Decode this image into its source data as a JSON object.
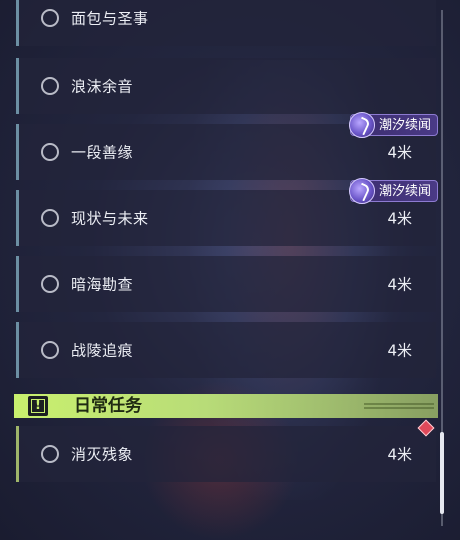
{
  "quests": [
    {
      "title": "面包与圣事",
      "distance": "",
      "tag": ""
    },
    {
      "title": "浪沫余音",
      "distance": "",
      "tag": ""
    },
    {
      "title": "一段善缘",
      "distance": "4米",
      "tag": "潮汐续闻"
    },
    {
      "title": "现状与未来",
      "distance": "4米",
      "tag": "潮汐续闻"
    },
    {
      "title": "暗海勘查",
      "distance": "4米",
      "tag": ""
    },
    {
      "title": "战陵追痕",
      "distance": "4米",
      "tag": ""
    }
  ],
  "daily_section": {
    "title": "日常任务",
    "icon": "exclamation-icon",
    "items": [
      {
        "title": "消灭残象",
        "distance": "4米"
      }
    ]
  },
  "scroll": {
    "position_fraction": 0.85
  },
  "colors": {
    "quest_border": "#6c8fa3",
    "daily_accent": "#c9f06e",
    "tag_purple": "#4a3a86",
    "alert_red": "#e0495a"
  }
}
